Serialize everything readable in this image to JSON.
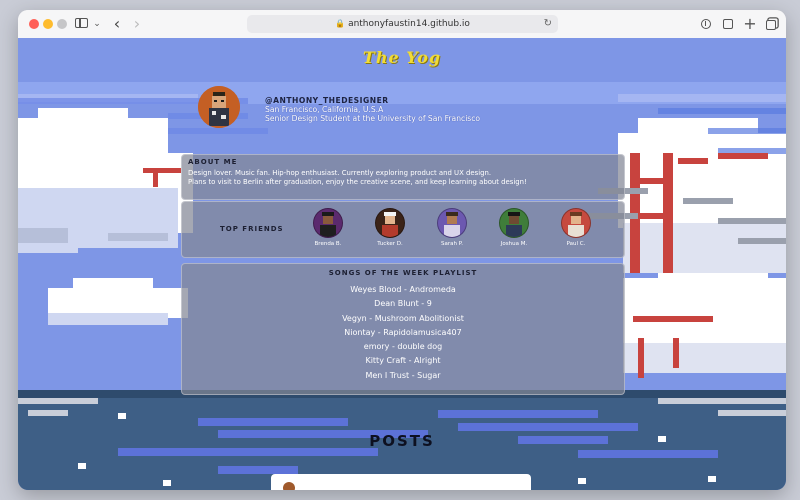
{
  "browser": {
    "url": "anthonyfaustin14.github.io"
  },
  "site": {
    "title": "The Yog"
  },
  "profile": {
    "handle": "@ANTHONY_THEDESIGNER",
    "location": "San Francisco, California, U.S.A",
    "role": "Senior Design Student at the University of San Francisco"
  },
  "about": {
    "title": "ABOUT ME",
    "line1": "Design lover. Music fan. Hip-hop enthusiast. Currently exploring product and UX design.",
    "line2": "Plans to visit to Berlin after graduation, enjoy the creative scene, and keep learning about design!"
  },
  "friends": {
    "title": "TOP FRIENDS",
    "items": [
      {
        "name": "Brenda B.",
        "color": "#5b2a6e"
      },
      {
        "name": "Tucker D.",
        "color": "#3b2318"
      },
      {
        "name": "Sarah P.",
        "color": "#6c58b0"
      },
      {
        "name": "Joshua M.",
        "color": "#3f7d3a"
      },
      {
        "name": "Paul C.",
        "color": "#c64a3f"
      }
    ]
  },
  "playlist": {
    "title": "SONGS OF THE WEEK PLAYLIST",
    "songs": [
      "Weyes Blood - Andromeda",
      "Dean Blunt - 9",
      "Vegyn - Mushroom Abolitionist",
      "Niontay - Rapidolamusica407",
      "emory - double dog",
      "Kitty Craft - Alright",
      "Men I Trust - Sugar"
    ]
  },
  "posts": {
    "title": "POSTS"
  },
  "colors": {
    "sky": "#7e96e6",
    "title_yellow": "#f2dc34",
    "bridge_red": "#c8433e",
    "water": "#3e5f86"
  }
}
